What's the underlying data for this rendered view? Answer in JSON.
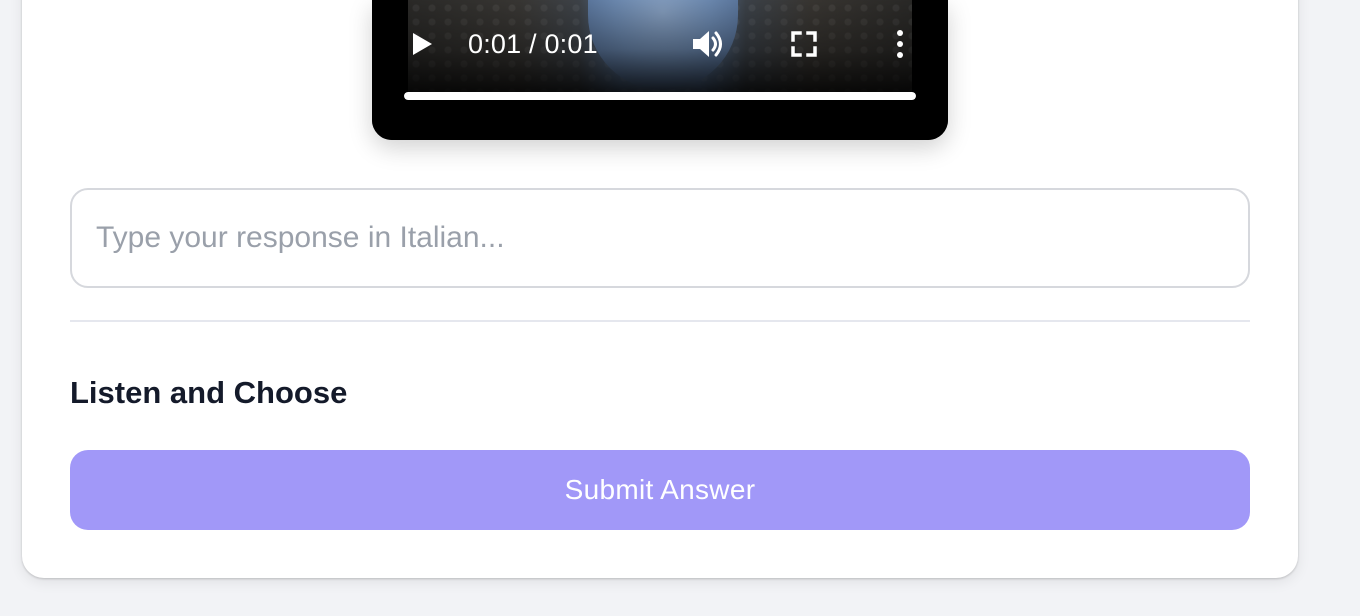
{
  "video_player": {
    "time_display": "0:01 / 0:01",
    "progress_fraction": 1.0,
    "icons": [
      "play-icon",
      "volume-icon",
      "fullscreen-icon",
      "more-options-icon"
    ]
  },
  "response": {
    "placeholder": "Type your response in Italian...",
    "value": ""
  },
  "section": {
    "title": "Listen and Choose"
  },
  "submit": {
    "label": "Submit Answer",
    "color": "#a198f8"
  }
}
